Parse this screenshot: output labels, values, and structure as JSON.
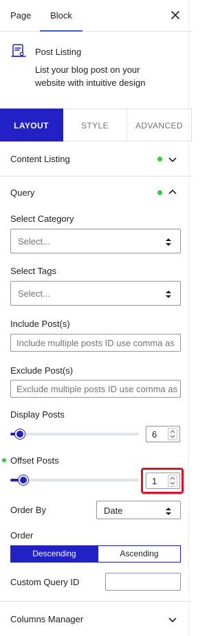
{
  "top_tabs": {
    "page": "Page",
    "block": "Block",
    "close_icon": "close-icon"
  },
  "block_card": {
    "icon": "post-listing-icon",
    "title": "Post Listing",
    "description": "List your blog post on your website with intuitive design"
  },
  "layout_tabs": [
    {
      "label": "LAYOUT",
      "active": true
    },
    {
      "label": "STYLE",
      "active": false
    },
    {
      "label": "ADVANCED",
      "active": false
    }
  ],
  "sections": {
    "content_listing": {
      "label": "Content Listing",
      "expanded": false
    },
    "query": {
      "label": "Query",
      "expanded": true
    },
    "columns_manager": {
      "label": "Columns Manager",
      "expanded": false
    }
  },
  "query": {
    "select_category": {
      "label": "Select Category",
      "value": "Select..."
    },
    "select_tags": {
      "label": "Select Tags",
      "value": "Select..."
    },
    "include_posts": {
      "label": "Include Post(s)",
      "placeholder": "Include multiple posts ID use comma as"
    },
    "exclude_posts": {
      "label": "Exclude Post(s)",
      "placeholder": "Exclude multiple posts ID use comma as"
    },
    "display_posts": {
      "label": "Display Posts",
      "value": "6"
    },
    "offset_posts": {
      "label": "Offset Posts",
      "value": "1"
    },
    "order_by": {
      "label": "Order By",
      "value": "Date"
    },
    "order": {
      "label": "Order",
      "options": [
        "Descending",
        "Ascending"
      ],
      "selected": "Descending"
    },
    "custom_query_id": {
      "label": "Custom Query ID",
      "value": ""
    }
  },
  "colors": {
    "accent": "#2121c6",
    "indicator": "#2ecc40",
    "highlight": "#e0102a",
    "top_tab_underline": "#3858e9"
  }
}
